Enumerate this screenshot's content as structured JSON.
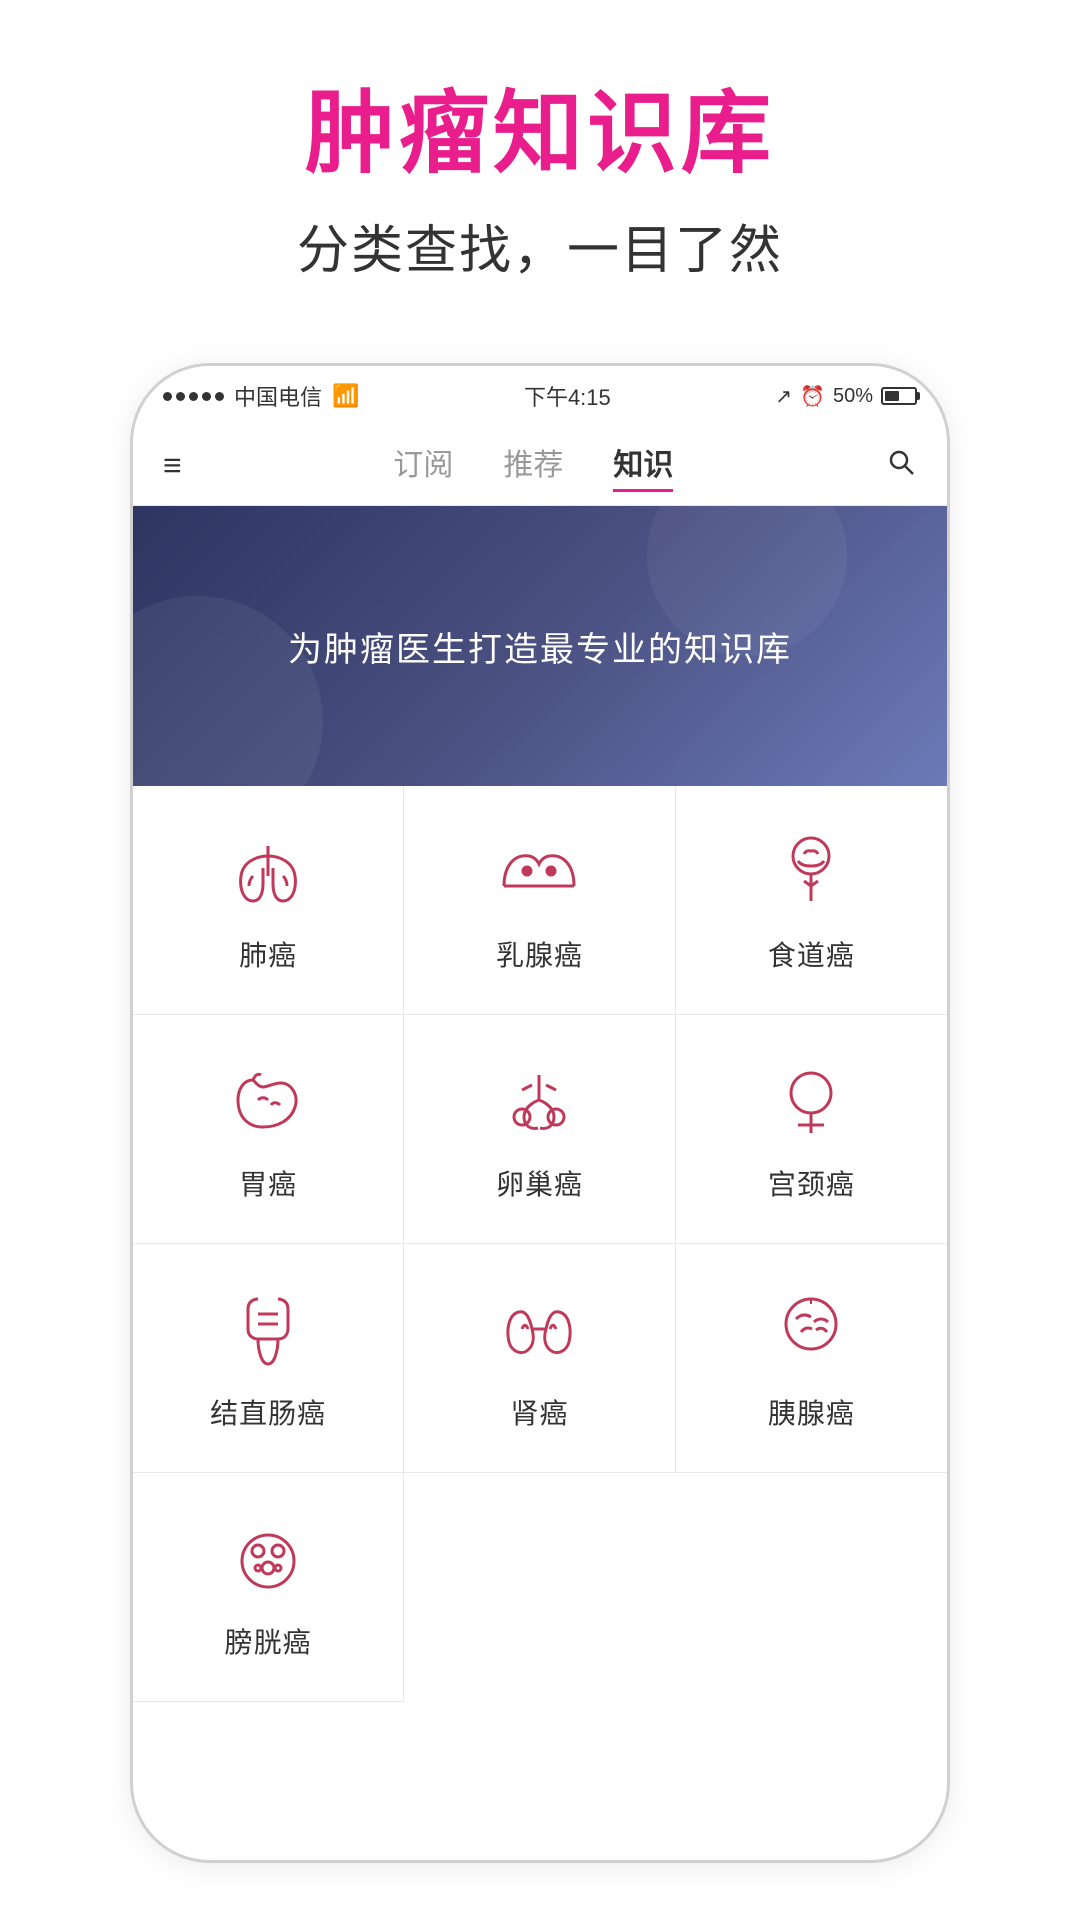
{
  "header": {
    "main_title": "肿瘤知识库",
    "subtitle": "分类查找，一目了然"
  },
  "status_bar": {
    "carrier": "中国电信",
    "wifi": "WiFi",
    "time": "下午4:15",
    "battery": "50%"
  },
  "nav": {
    "menu_label": "☰",
    "tabs": [
      {
        "id": "subscribe",
        "label": "订阅",
        "active": false
      },
      {
        "id": "recommend",
        "label": "推荐",
        "active": false
      },
      {
        "id": "knowledge",
        "label": "知识",
        "active": true
      }
    ]
  },
  "banner": {
    "text": "为肿瘤医生打造最专业的知识库"
  },
  "cancer_types": [
    {
      "id": "lung",
      "label": "肺癌",
      "icon": "lung"
    },
    {
      "id": "breast",
      "label": "乳腺癌",
      "icon": "breast"
    },
    {
      "id": "esophagus",
      "label": "食道癌",
      "icon": "esophagus"
    },
    {
      "id": "stomach",
      "label": "胃癌",
      "icon": "stomach"
    },
    {
      "id": "ovary",
      "label": "卵巢癌",
      "icon": "ovary"
    },
    {
      "id": "cervix",
      "label": "宫颈癌",
      "icon": "cervix"
    },
    {
      "id": "colorectal",
      "label": "结直肠癌",
      "icon": "colorectal"
    },
    {
      "id": "kidney",
      "label": "肾癌",
      "icon": "kidney"
    },
    {
      "id": "pancreas",
      "label": "胰腺癌",
      "icon": "pancreas"
    },
    {
      "id": "bladder",
      "label": "膀胱癌",
      "icon": "bladder"
    }
  ]
}
